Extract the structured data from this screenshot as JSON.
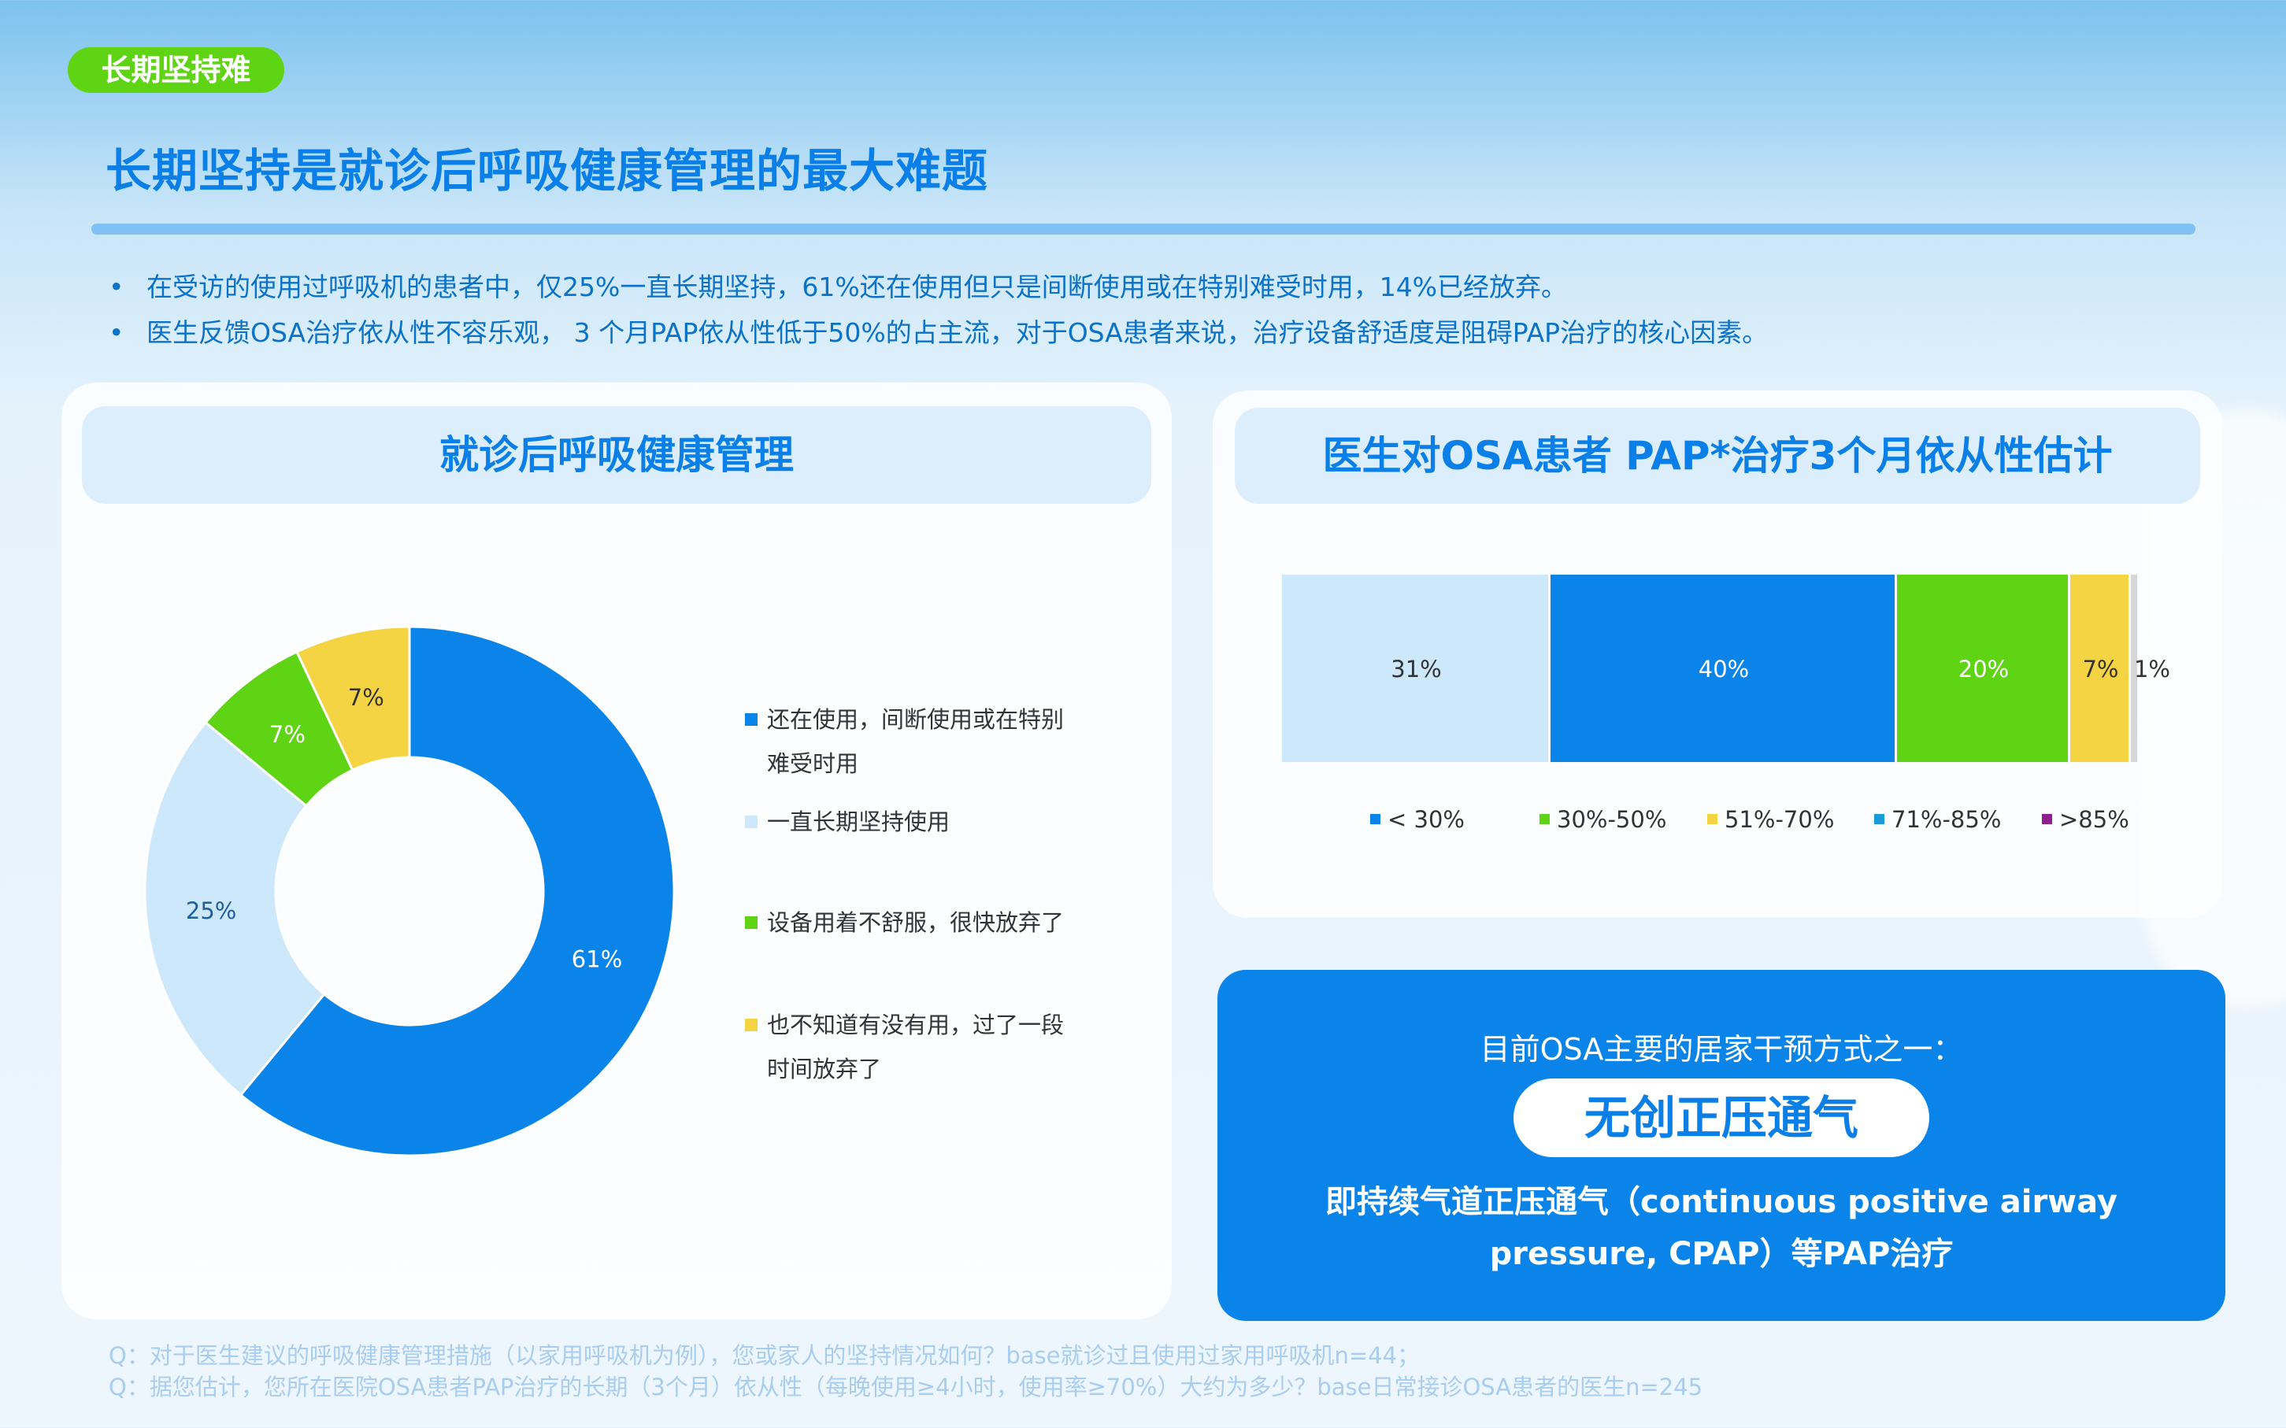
{
  "tag": "长期坚持难",
  "page_title": "长期坚持是就诊后呼吸健康管理的最大难题",
  "bullets": [
    "在受访的使用过呼吸机的患者中，仅25%一直长期坚持，61%还在使用但只是间断使用或在特别难受时用，14%已经放弃。",
    "医生反馈OSA治疗依从性不容乐观， 3 个月PAP依从性低于50%的占主流，对于OSA患者来说，治疗设备舒适度是阻碍PAP治疗的核心因素。"
  ],
  "bullet_mark": "•",
  "left_panel": {
    "title": "就诊后呼吸健康管理"
  },
  "right_panel": {
    "title": "医生对OSA患者 PAP*治疗3个月依从性估计"
  },
  "chart_data": [
    {
      "type": "pie",
      "donut": true,
      "title": "就诊后呼吸健康管理",
      "slices": [
        {
          "label": "还在使用，间断使用或在特别难受时用",
          "value": 61,
          "display": "61%",
          "color": "#0a84e8",
          "label_color": "#ffffff"
        },
        {
          "label": "一直长期坚持使用",
          "value": 25,
          "display": "25%",
          "color": "#cde7fb",
          "label_color": "#1f5f9c"
        },
        {
          "label": "设备用着不舒服，很快放弃了",
          "value": 7,
          "display": "7%",
          "color": "#5ed414",
          "label_color": "#ffffff"
        },
        {
          "label": "也不知道有没有用，过了一段时间放弃了",
          "value": 7,
          "display": "7%",
          "color": "#f5d443",
          "label_color": "#333333"
        }
      ],
      "legend": [
        {
          "lines": [
            "还在使用，间断使用或在特别",
            "难受时用"
          ],
          "color": "#0a84e8"
        },
        {
          "lines": [
            "一直长期坚持使用"
          ],
          "color": "#cde7fb"
        },
        {
          "lines": [
            "设备用着不舒服，很快放弃了"
          ],
          "color": "#5ed414"
        },
        {
          "lines": [
            "也不知道有没有用，过了一段",
            "时间放弃了"
          ],
          "color": "#f5d443"
        }
      ],
      "legend_placement": "right"
    },
    {
      "type": "bar",
      "stacked": true,
      "orientation": "horizontal",
      "percent_stacked": true,
      "title": "医生对OSA患者 PAP*治疗3个月依从性估计",
      "segments": [
        {
          "value": 31,
          "display": "31%",
          "color": "#cde7fb",
          "label_color": "#333333"
        },
        {
          "value": 40,
          "display": "40%",
          "color": "#0a84e8",
          "label_color": "#ffffff"
        },
        {
          "value": 20,
          "display": "20%",
          "color": "#5ed414",
          "label_color": "#ffffff"
        },
        {
          "value": 7,
          "display": "7%",
          "color": "#f5d443",
          "label_color": "#333333"
        },
        {
          "value": 1,
          "display": "1%",
          "color": "#d6d6d6",
          "label_color": "#333333"
        }
      ],
      "legend": [
        {
          "label": "< 30%",
          "color": "#0a84e8"
        },
        {
          "label": "30%-50%",
          "color": "#5ed414"
        },
        {
          "label": "51%-70%",
          "color": "#f5d443"
        },
        {
          "label": "71%-85%",
          "color": "#1a9ad6"
        },
        {
          "label": ">85%",
          "color": "#8e1f8c"
        }
      ],
      "legend_placement": "bottom"
    }
  ],
  "callout": {
    "line1": "目前OSA主要的居家干预方式之一：",
    "highlight": "无创正压通气",
    "line3": "即持续气道正压通气（continuous positive airway pressure, CPAP）等PAP治疗"
  },
  "notes": [
    "Q：对于医生建议的呼吸健康管理措施（以家用呼吸机为例），您或家人的坚持情况如何？base就诊过且使用过家用呼吸机n=44；",
    "Q：据您估计，您所在医院OSA患者PAP治疗的长期（3个月）依从性（每晚使用≥4小时，使用率≥70%）大约为多少？base日常接诊OSA患者的医生n=245"
  ],
  "colors": {
    "accent_blue": "#0a7fe8",
    "green": "#5ed414",
    "yellow": "#f5d443",
    "light_blue": "#cde7fb"
  }
}
